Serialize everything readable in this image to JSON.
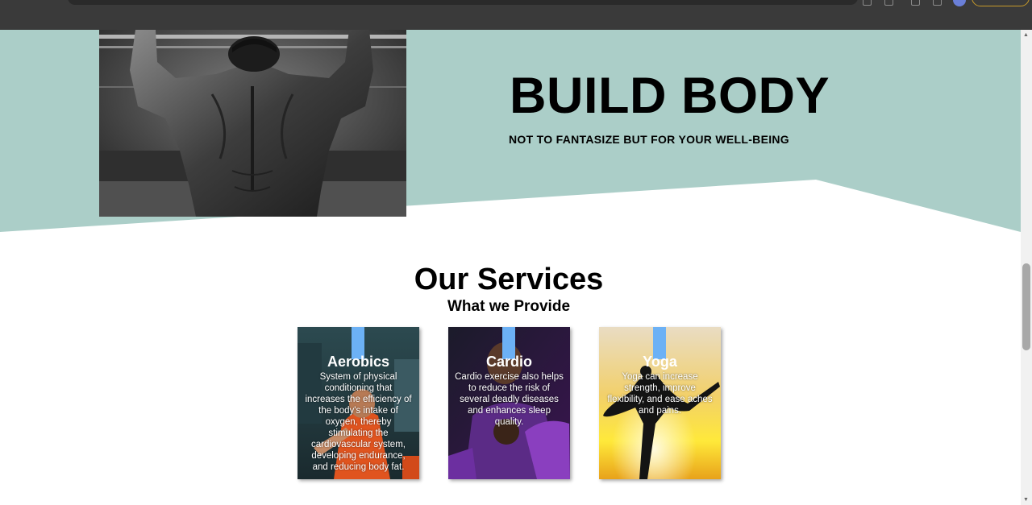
{
  "hero": {
    "title": "BUILD BODY",
    "subtitle": "NOT TO FANTASIZE BUT FOR YOUR WELL-BEING",
    "image_icon": "athlete-pullup-photo",
    "background_color": "#abcec8"
  },
  "services": {
    "title": "Our Services",
    "subtitle": "What we Provide",
    "accent_color": "#6cb1f5",
    "cards": [
      {
        "title": "Aerobics",
        "text": "System of physical conditioning that increases the efficiency of the body's intake of oxygen, thereby stimulating the cardiovascular system, developing endurance, and reducing body fat.",
        "image_icon": "aerobics-photo"
      },
      {
        "title": "Cardio",
        "text": "Cardio exercise also helps to reduce the risk of several deadly diseases and enhances sleep quality.",
        "image_icon": "boxing-photo"
      },
      {
        "title": "Yoga",
        "text": "Yoga can increase strength, improve flexibility, and ease aches and pains.",
        "image_icon": "yoga-silhouette-photo"
      }
    ]
  }
}
